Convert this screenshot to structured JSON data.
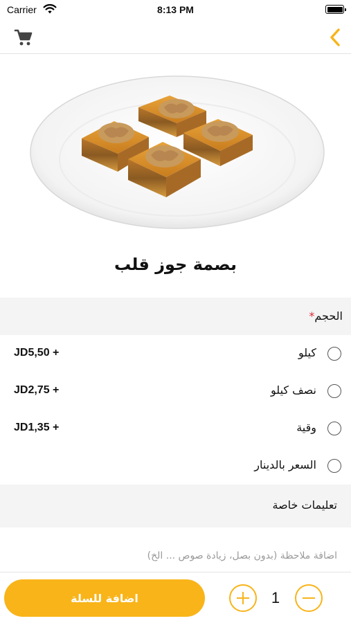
{
  "status_bar": {
    "carrier": "Carrier",
    "time": "8:13 PM",
    "icons": [
      "wifi-icon",
      "battery-icon"
    ]
  },
  "nav": {
    "left_icon": "cart-icon",
    "right_icon": "back-chevron-icon",
    "accent_color": "#f8b419"
  },
  "product": {
    "image": "basma-walnut-pastry-plate",
    "title": "بصمة جوز قلب"
  },
  "size_section": {
    "label": "الحجم",
    "required_mark": "*",
    "options": [
      {
        "label": "كيلو",
        "price": "JD5,50 +"
      },
      {
        "label": "نصف كيلو",
        "price": "JD2,75 +"
      },
      {
        "label": "وقية",
        "price": "JD1,35 +"
      },
      {
        "label": "السعر بالدينار",
        "price": ""
      }
    ]
  },
  "instructions": {
    "label": "تعليمات خاصة",
    "placeholder": "اضافة ملاحظة (بدون بصل، زيادة صوص ... الخ)"
  },
  "bottom_bar": {
    "add_to_cart": "اضافة للسلة",
    "quantity": "1"
  }
}
